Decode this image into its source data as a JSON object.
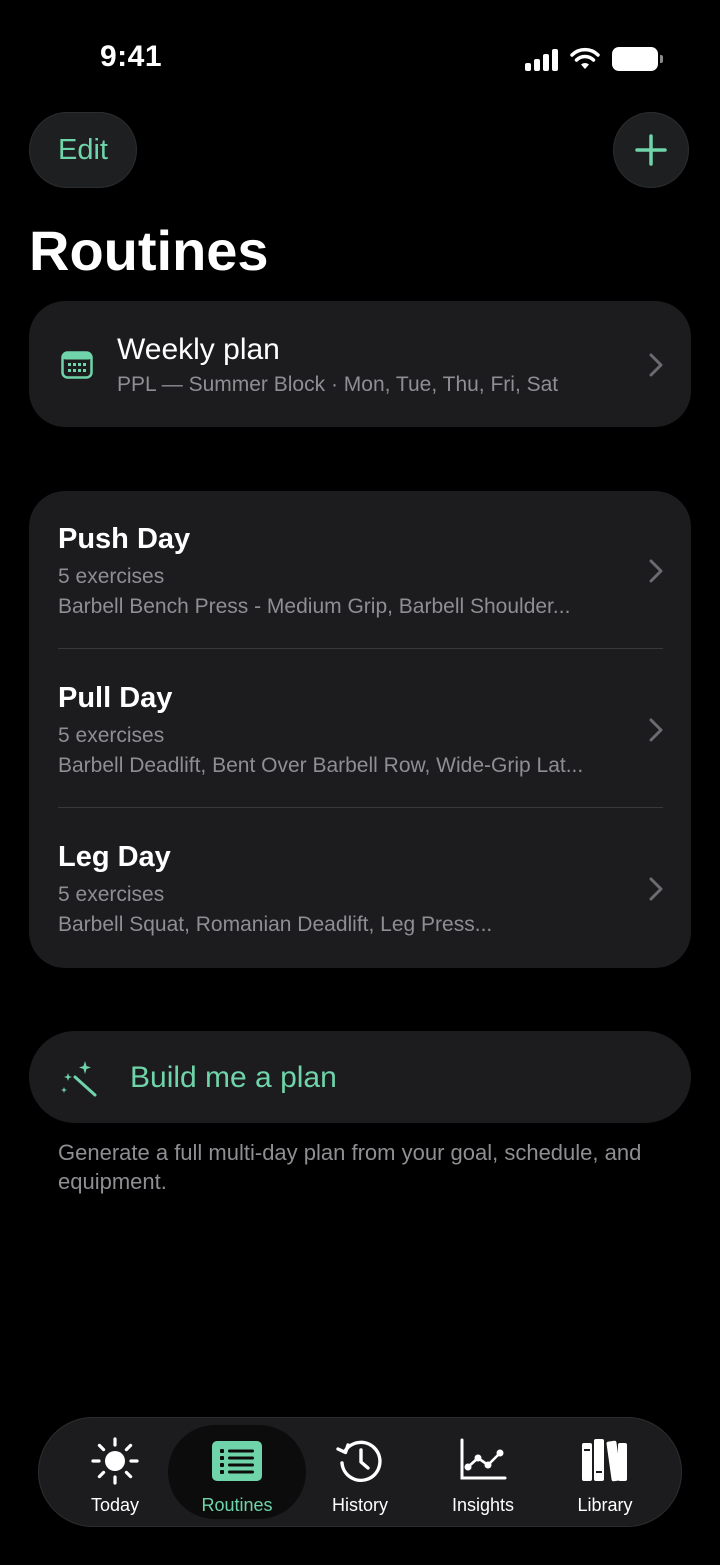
{
  "status_bar": {
    "time": "9:41"
  },
  "header": {
    "edit_label": "Edit",
    "title": "Routines"
  },
  "weekly_plan": {
    "title": "Weekly plan",
    "subtitle": "PPL — Summer Block · Mon, Tue, Thu, Fri, Sat"
  },
  "routines": [
    {
      "name": "Push Day",
      "count": "5 exercises",
      "exercises": "Barbell Bench Press - Medium Grip, Barbell Shoulder..."
    },
    {
      "name": "Pull Day",
      "count": "5 exercises",
      "exercises": "Barbell Deadlift, Bent Over Barbell Row, Wide-Grip Lat..."
    },
    {
      "name": "Leg Day",
      "count": "5 exercises",
      "exercises": "Barbell Squat, Romanian Deadlift, Leg Press..."
    }
  ],
  "build_plan": {
    "label": "Build me a plan",
    "caption": "Generate a full multi-day plan from your goal, schedule, and equipment."
  },
  "tabs": [
    {
      "label": "Today",
      "icon": "sun-icon"
    },
    {
      "label": "Routines",
      "icon": "list-icon",
      "active": true
    },
    {
      "label": "History",
      "icon": "history-icon"
    },
    {
      "label": "Insights",
      "icon": "chart-icon"
    },
    {
      "label": "Library",
      "icon": "books-icon"
    }
  ],
  "colors": {
    "accent": "#6fd4a9",
    "background": "#000000",
    "card": "#1c1c1e",
    "secondary_text": "#8e8e93"
  }
}
